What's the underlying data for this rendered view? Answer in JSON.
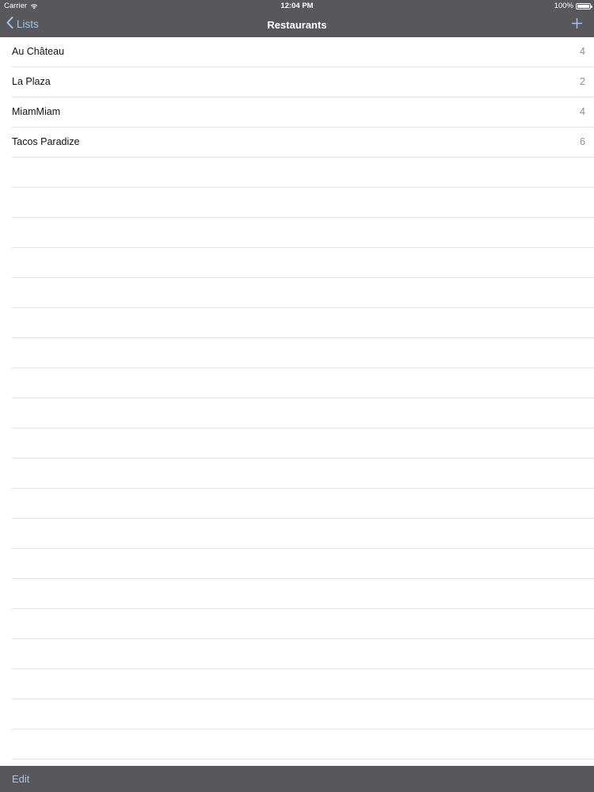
{
  "status_bar": {
    "carrier": "Carrier",
    "time": "12:04 PM",
    "battery": "100%",
    "battery_level": 1.0
  },
  "nav_bar": {
    "back_label": "Lists",
    "title": "Restaurants",
    "add_icon": "plus-icon",
    "back_icon": "chevron-left-icon"
  },
  "list": {
    "items": [
      {
        "name": "Au Château",
        "count": "4"
      },
      {
        "name": "La Plaza",
        "count": "2"
      },
      {
        "name": "MiamMiam",
        "count": "4"
      },
      {
        "name": "Tacos Paradize",
        "count": "6"
      }
    ]
  },
  "toolbar": {
    "edit_label": "Edit"
  },
  "colors": {
    "bar_background": "#58585c",
    "accent": "#9fc6ea",
    "separator": "#e3e3e6",
    "count_text": "#8e8e93"
  }
}
